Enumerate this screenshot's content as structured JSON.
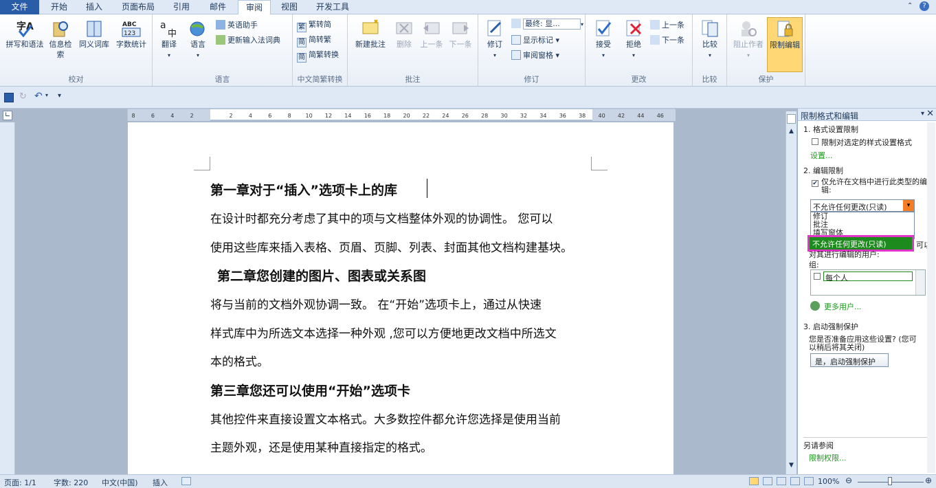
{
  "tabs": [
    "文件",
    "开始",
    "插入",
    "页面布局",
    "引用",
    "邮件",
    "审阅",
    "视图",
    "开发工具"
  ],
  "groups": {
    "proof": "校对",
    "lang": "语言",
    "zh": "中文简繁转换",
    "comment": "批注",
    "track": "修订",
    "changes": "更改",
    "compare": "比较",
    "protect": "保护"
  },
  "buttons": {
    "spell": "拼写和语法",
    "research": "信息检索",
    "thesaurus": "同义词库",
    "wordcount": "字数统计",
    "translate": "翻译",
    "language": "语言",
    "eng": "英语助手",
    "ime": "更新输入法词典",
    "t2s": "繁转简",
    "s2t": "简转繁",
    "conv": "简繁转换",
    "newcomment": "新建批注",
    "delete": "删除",
    "prev": "上一条",
    "next": "下一条",
    "track": "修订",
    "final": "最终: 显...",
    "showmarkup": "显示标记",
    "reviewpane": "审阅窗格",
    "accept": "接受",
    "reject": "拒绝",
    "prevchange": "上一条",
    "nextchange": "下一条",
    "compare": "比较",
    "block": "阻止作者",
    "restrict": "限制编辑"
  },
  "doc": {
    "h1": "第一章对于“插入”选项卡上的库",
    "p1": "在设计时都充分考虑了其中的项与文档整体外观的协调性。  您可以",
    "p2": "使用这些库来插入表格、页眉、页脚、列表、封面其他文档构建基块。",
    "h2": "第二章您创建的图片、图表或关系图",
    "p3": "将与当前的文档外观协调一致。  在“开始”选项卡上，通过从快速",
    "p4": "样式库中为所选文本选择一种外观 ,您可以方便地更改文档中所选文",
    "p5": "本的格式。",
    "h3": "第三章您还可以使用“开始”选项卡",
    "p6": "其他控件来直接设置文本格式。大多数控件都允许您选择是使用当前",
    "p7": "主题外观，还是使用某种直接指定的格式。"
  },
  "pane": {
    "title": "限制格式和编辑",
    "s1": "1. 格式设置限制",
    "cb1": "限制对选定的样式设置格式",
    "settings": "设置...",
    "s2": "2. 编辑限制",
    "cb2": "仅允许在文档中进行此类型的编辑:",
    "select": "不允许任何更改(只读)",
    "options": [
      "修订",
      "批注",
      "填写窗体",
      "不允许任何更改(只读)"
    ],
    "exc_tail": "可以",
    "exc2": "对其进行编辑的用户:",
    "group_label": "组:",
    "everyone": "每个人",
    "moreusers": "更多用户...",
    "s3": "3. 启动强制保护",
    "q1": "您是否准备应用这些设置? (您可",
    "q2": "以稍后将其关闭)",
    "start": "是，启动强制保护",
    "seealso": "另请参阅",
    "restrict_perm": "限制权限..."
  },
  "status": {
    "page": "页面: 1/1",
    "words": "字数: 220",
    "lang": "中文(中国)",
    "mode": "插入",
    "zoom": "100%"
  },
  "ruler": {
    "h": [
      "8",
      "6",
      "4",
      "2",
      "",
      "2",
      "4",
      "6",
      "8",
      "10",
      "12",
      "14",
      "16",
      "18",
      "20",
      "22",
      "24",
      "26",
      "28",
      "30",
      "32",
      "34",
      "36",
      "38",
      "40",
      "42",
      "44",
      "46",
      "48"
    ]
  },
  "colors": {
    "accent": "#2a5da8",
    "highlight": "#e234c8",
    "selected": "#1c8a1c",
    "restrict_active": "#ffd774"
  }
}
